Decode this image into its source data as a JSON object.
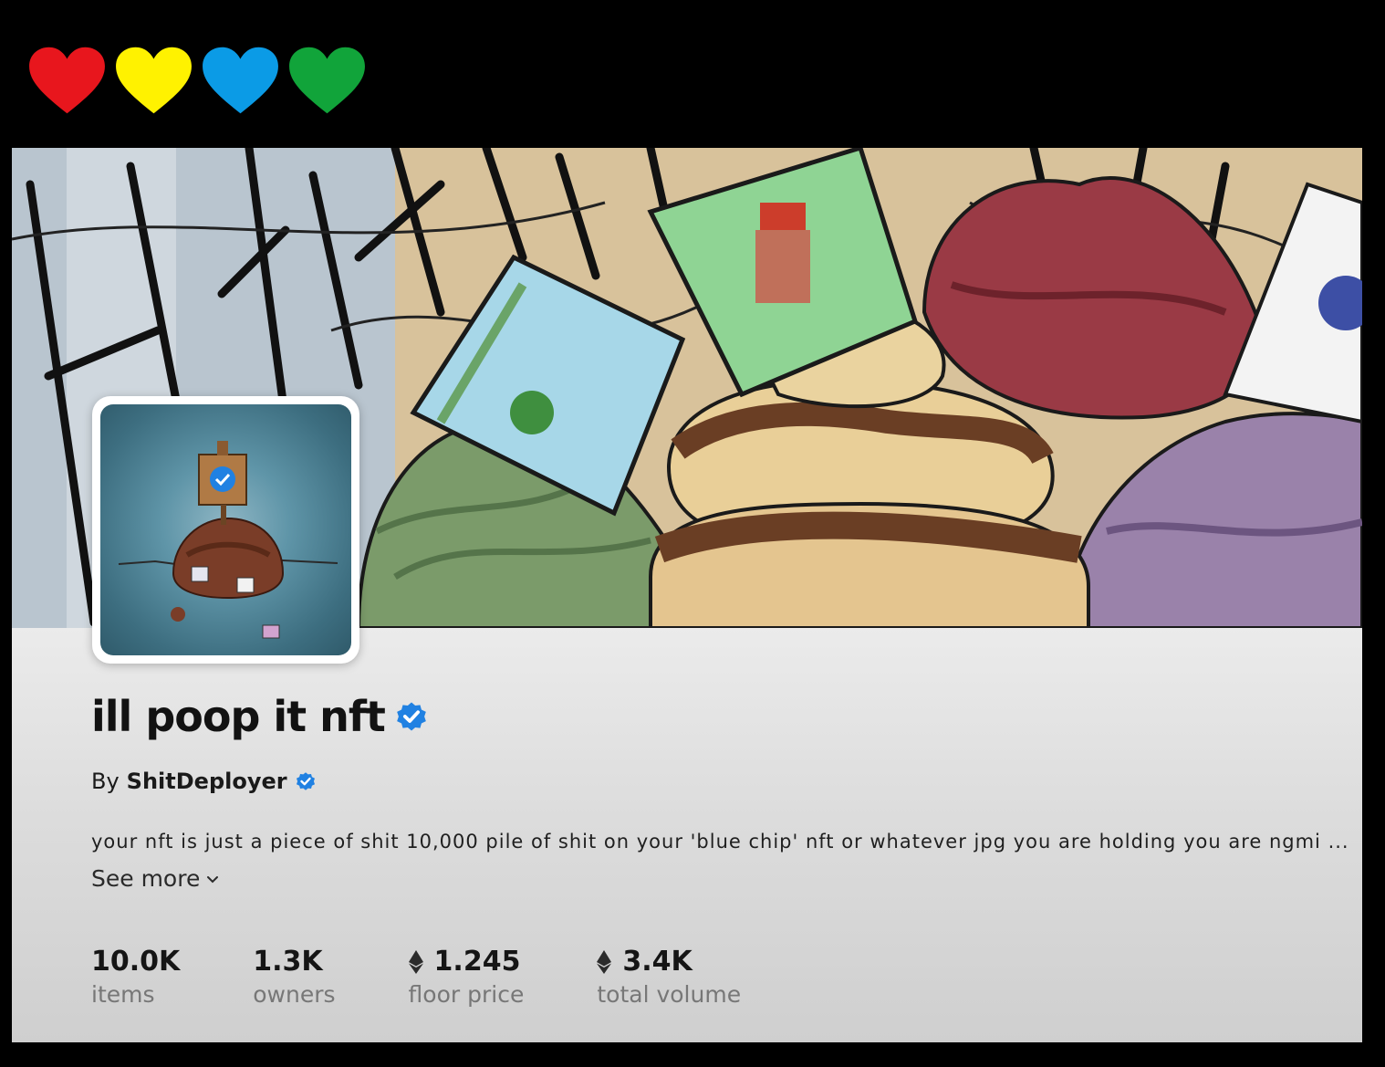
{
  "hearts": [
    {
      "name": "red-heart-icon",
      "color": "#e8161d"
    },
    {
      "name": "yellow-heart-icon",
      "color": "#fff200"
    },
    {
      "name": "blue-heart-icon",
      "color": "#0b9be6"
    },
    {
      "name": "green-heart-icon",
      "color": "#11a43a"
    }
  ],
  "collection": {
    "name": "ill poop it nft",
    "verified": true
  },
  "creator": {
    "prefix": "By",
    "name": "ShitDeployer",
    "verified": true
  },
  "description": {
    "text": "your nft is just a piece of shit 10,000 pile of shit on your 'blue chip' nft or whatever jpg you are holding you are ngmi ...",
    "see_more_label": "See more"
  },
  "stats": [
    {
      "value": "10.0K",
      "label": "items",
      "eth": false
    },
    {
      "value": "1.3K",
      "label": "owners",
      "eth": false
    },
    {
      "value": "1.245",
      "label": "floor price",
      "eth": true
    },
    {
      "value": "3.4K",
      "label": "total volume",
      "eth": true
    }
  ],
  "colors": {
    "verified_blue": "#2081e2",
    "background": "#000000"
  }
}
